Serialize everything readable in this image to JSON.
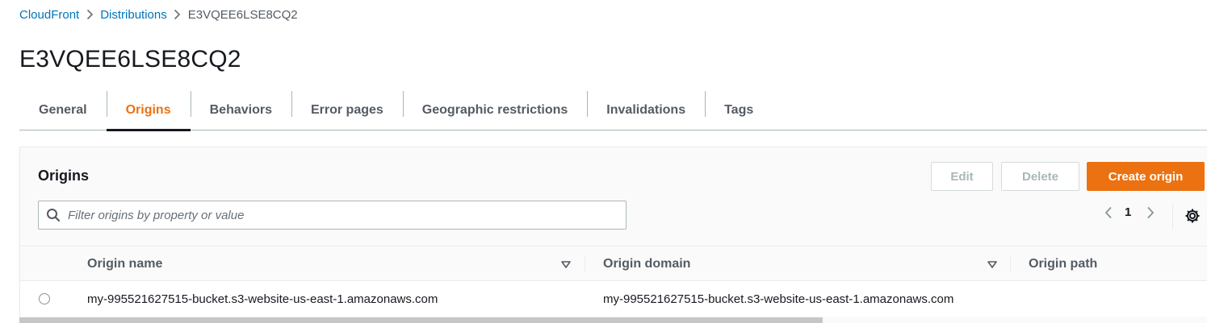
{
  "breadcrumb": {
    "items": [
      "CloudFront",
      "Distributions"
    ],
    "current": "E3VQEE6LSE8CQ2"
  },
  "page_title": "E3VQEE6LSE8CQ2",
  "tabs": [
    "General",
    "Origins",
    "Behaviors",
    "Error pages",
    "Geographic restrictions",
    "Invalidations",
    "Tags"
  ],
  "active_tab": "Origins",
  "origins": {
    "title": "Origins",
    "edit_label": "Edit",
    "delete_label": "Delete",
    "create_label": "Create origin",
    "filter_placeholder": "Filter origins by property or value",
    "filter_value": "",
    "page_number": "1",
    "columns": [
      "Origin name",
      "Origin domain",
      "Origin path"
    ],
    "rows": [
      {
        "name": "my-995521627515-bucket.s3-website-us-east-1.amazonaws.com",
        "domain": "my-995521627515-bucket.s3-website-us-east-1.amazonaws.com",
        "path": ""
      }
    ]
  },
  "colors": {
    "link": "#0073bb",
    "accent": "#ec7211",
    "text": "#16191f",
    "muted": "#545b64",
    "border": "#aab7b8"
  },
  "icons": [
    "chevron-right-icon",
    "search-icon",
    "chevron-left-icon",
    "settings-gear-icon",
    "sort-caret-down-icon"
  ]
}
